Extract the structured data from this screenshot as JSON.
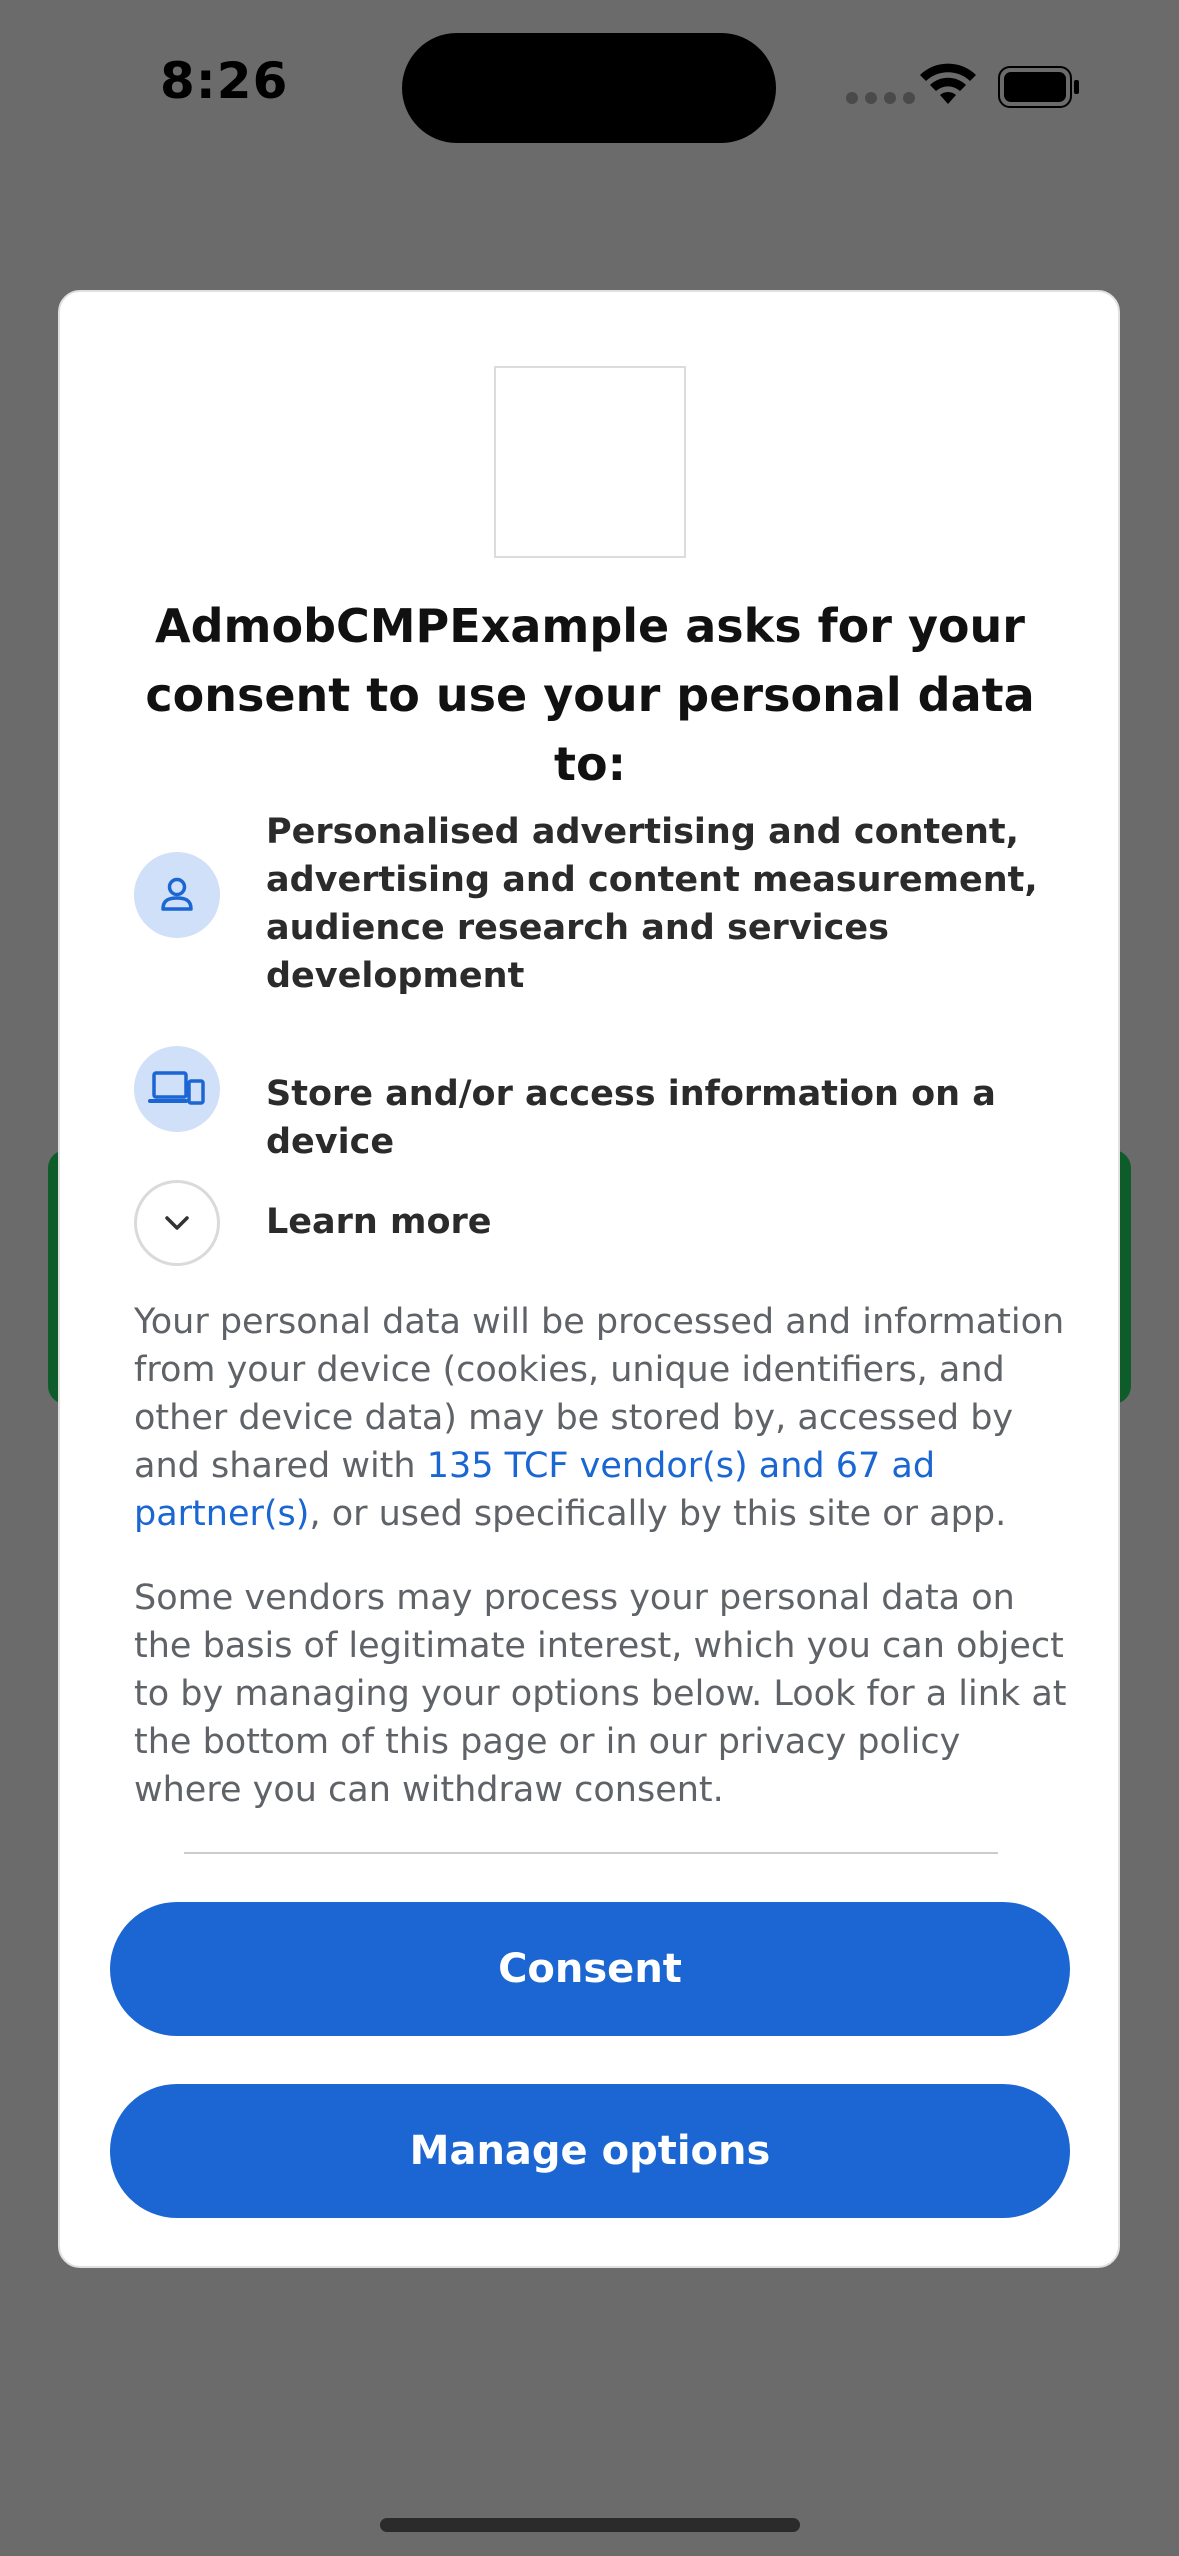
{
  "status_bar": {
    "time": "8:26"
  },
  "dialog": {
    "title": "AdmobCMPExample asks for your consent to use your personal data to:",
    "purposes": [
      {
        "icon": "person-icon",
        "label": "Personalised advertising and content, advertising and content measurement, audience research and services development"
      },
      {
        "icon": "devices-icon",
        "label": "Store and/or access information on a device"
      }
    ],
    "learn_more_label": "Learn more",
    "paragraph1_before": "Your personal data will be processed and information from your device (cookies, unique identifiers, and other device data) may be stored by, accessed by and shared with ",
    "paragraph1_link": "135 TCF vendor(s) and 67 ad partner(s)",
    "paragraph1_after": ", or used specifically by this site or app.",
    "paragraph2": "Some vendors may process your personal data on the basis of legitimate interest, which you can object to by managing your options below. Look for a link at the bottom of this page or in our privacy policy where you can withdraw consent.",
    "consent_button": "Consent",
    "manage_button": "Manage options"
  },
  "colors": {
    "accent": "#1b66d2",
    "icon_bg": "#cfe0f8",
    "overlay": "#6b6b6b"
  }
}
